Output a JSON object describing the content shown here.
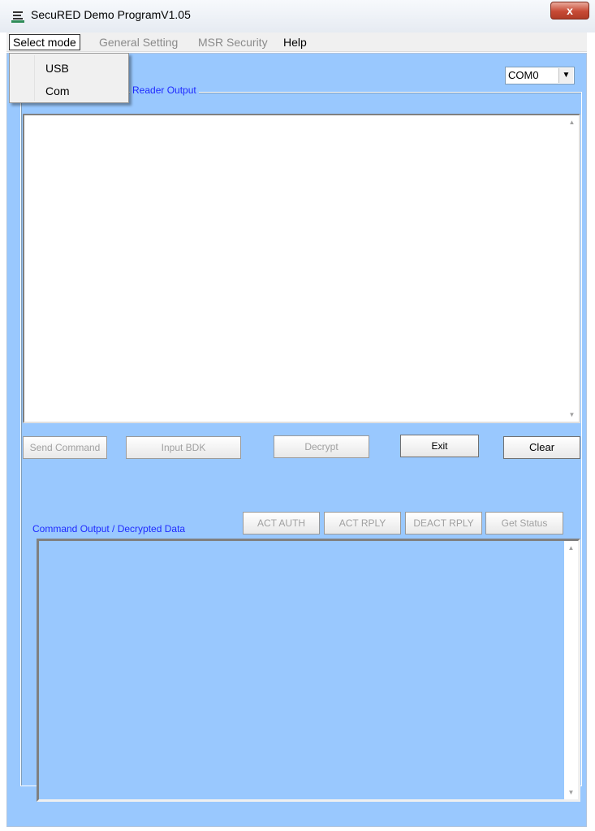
{
  "window": {
    "title": "SecuRED Demo ProgramV1.05",
    "close_label": "x"
  },
  "menu": {
    "items": [
      "Select mode",
      "General Setting",
      "MSR Security",
      "Help"
    ]
  },
  "dropdown": {
    "items": [
      "USB",
      "Com"
    ]
  },
  "port_select": {
    "value": "COM0"
  },
  "reader_output": {
    "label": "Reader Output"
  },
  "buttons": {
    "send_command": "Send Command",
    "input_bdk": "Input BDK",
    "decrypt": "Decrypt",
    "exit": "Exit",
    "clear": "Clear",
    "act_auth": "ACT AUTH",
    "act_rply": "ACT RPLY",
    "deact_rply": "DEACT RPLY",
    "get_status": "Get Status"
  },
  "command_output": {
    "label": "Command Output / Decrypted Data"
  },
  "colors": {
    "client_bg": "#99c8fe",
    "label_blue": "#1f2aff",
    "close_red": "#c74a35"
  }
}
